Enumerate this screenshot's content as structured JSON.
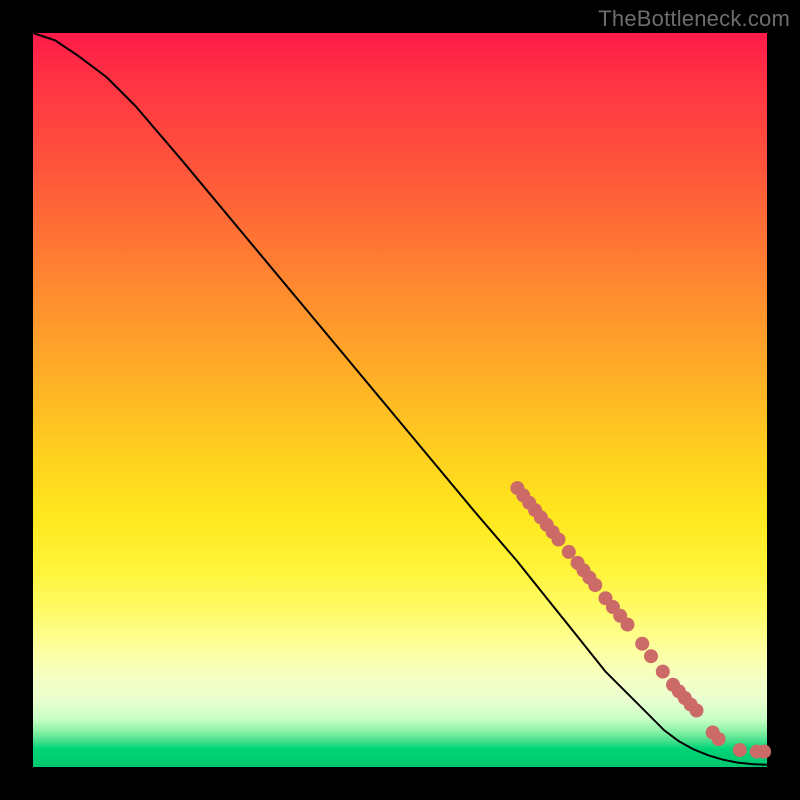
{
  "watermark": "TheBottleneck.com",
  "colors": {
    "marker": "#cb6a66",
    "line": "#000000",
    "background_border": "#000000"
  },
  "chart_data": {
    "type": "line",
    "title": "",
    "xlabel": "",
    "ylabel": "",
    "xlim": [
      0,
      100
    ],
    "ylim": [
      0,
      100
    ],
    "grid": false,
    "legend": false,
    "series": [
      {
        "name": "bottleneck-curve",
        "x": [
          0,
          3,
          6,
          10,
          14,
          20,
          30,
          40,
          50,
          60,
          66,
          70,
          74,
          78,
          82,
          86,
          88,
          90,
          92,
          94,
          96,
          98,
          100
        ],
        "y": [
          100,
          99,
          97,
          94,
          90,
          83,
          71,
          59,
          47,
          35,
          28,
          23,
          18,
          13,
          9,
          5,
          3.5,
          2.4,
          1.6,
          1.0,
          0.6,
          0.4,
          0.3
        ]
      }
    ],
    "markers": [
      {
        "x": 66.0,
        "y": 38.0
      },
      {
        "x": 66.8,
        "y": 37.0
      },
      {
        "x": 67.6,
        "y": 36.0
      },
      {
        "x": 68.4,
        "y": 35.0
      },
      {
        "x": 69.2,
        "y": 34.0
      },
      {
        "x": 70.0,
        "y": 33.0
      },
      {
        "x": 70.8,
        "y": 32.0
      },
      {
        "x": 71.6,
        "y": 31.0
      },
      {
        "x": 73.0,
        "y": 29.3
      },
      {
        "x": 74.2,
        "y": 27.8
      },
      {
        "x": 75.0,
        "y": 26.8
      },
      {
        "x": 75.8,
        "y": 25.8
      },
      {
        "x": 76.6,
        "y": 24.8
      },
      {
        "x": 78.0,
        "y": 23.0
      },
      {
        "x": 79.0,
        "y": 21.8
      },
      {
        "x": 80.0,
        "y": 20.6
      },
      {
        "x": 81.0,
        "y": 19.4
      },
      {
        "x": 83.0,
        "y": 16.8
      },
      {
        "x": 84.2,
        "y": 15.1
      },
      {
        "x": 85.8,
        "y": 13.0
      },
      {
        "x": 87.2,
        "y": 11.2
      },
      {
        "x": 88.0,
        "y": 10.3
      },
      {
        "x": 88.8,
        "y": 9.4
      },
      {
        "x": 89.6,
        "y": 8.5
      },
      {
        "x": 90.4,
        "y": 7.7
      },
      {
        "x": 92.6,
        "y": 4.7
      },
      {
        "x": 93.4,
        "y": 3.8
      },
      {
        "x": 96.3,
        "y": 2.3
      },
      {
        "x": 98.6,
        "y": 2.1
      },
      {
        "x": 99.6,
        "y": 2.1
      }
    ],
    "marker_radius_px": 7
  }
}
